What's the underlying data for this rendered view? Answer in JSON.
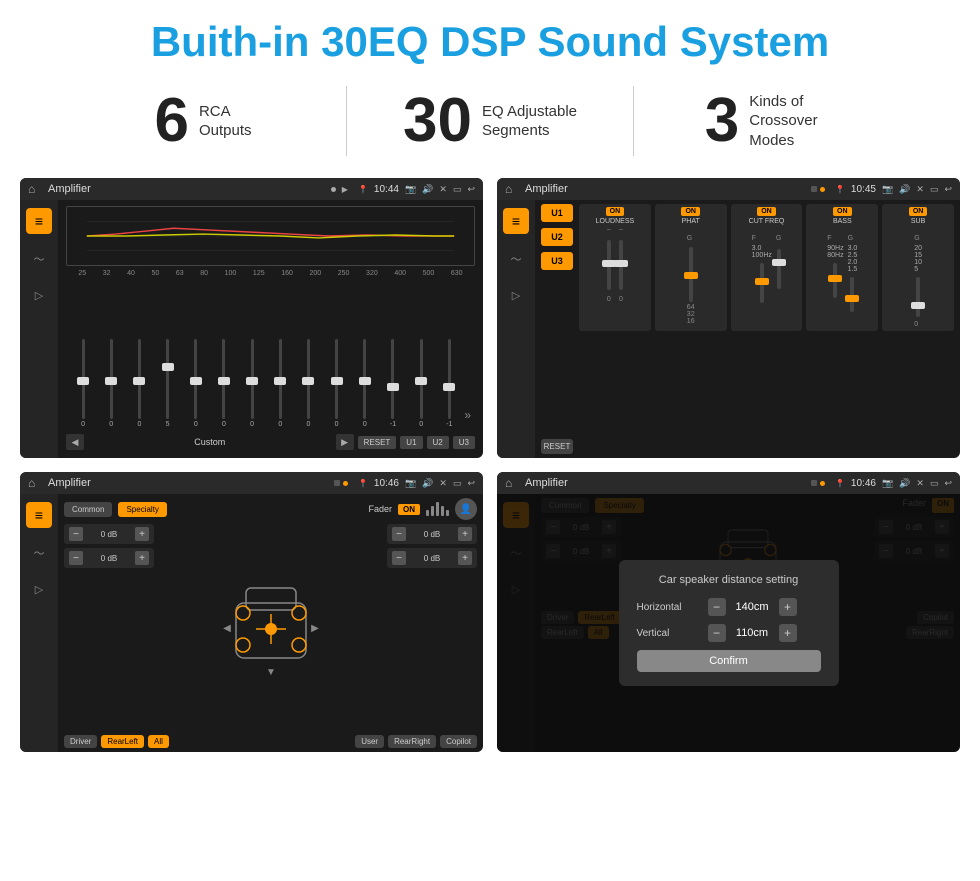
{
  "header": {
    "title": "Buith-in 30EQ DSP Sound System"
  },
  "stats": [
    {
      "number": "6",
      "label": "RCA\nOutputs"
    },
    {
      "number": "30",
      "label": "EQ Adjustable\nSegments"
    },
    {
      "number": "3",
      "label": "Kinds of\nCrossover Modes"
    }
  ],
  "screens": [
    {
      "id": "screen1",
      "appName": "Amplifier",
      "time": "10:44",
      "type": "eq"
    },
    {
      "id": "screen2",
      "appName": "Amplifier",
      "time": "10:45",
      "type": "amp"
    },
    {
      "id": "screen3",
      "appName": "Amplifier",
      "time": "10:46",
      "type": "crossover"
    },
    {
      "id": "screen4",
      "appName": "Amplifier",
      "time": "10:46",
      "type": "dialog"
    }
  ],
  "eq": {
    "freqLabels": [
      "25",
      "32",
      "40",
      "50",
      "63",
      "80",
      "100",
      "125",
      "160",
      "200",
      "250",
      "320",
      "400",
      "500",
      "630"
    ],
    "sliderValues": [
      "0",
      "0",
      "0",
      "5",
      "0",
      "0",
      "0",
      "0",
      "0",
      "0",
      "0",
      "-1",
      "0",
      "-1"
    ],
    "presets": [
      "Custom",
      "RESET",
      "U1",
      "U2",
      "U3"
    ]
  },
  "amp": {
    "presets": [
      "U1",
      "U2",
      "U3"
    ],
    "modules": [
      "LOUDNESS",
      "PHAT",
      "CUT FREQ",
      "BASS",
      "SUB"
    ]
  },
  "crossover": {
    "tabs": [
      "Common",
      "Specialty"
    ],
    "faderLabel": "Fader",
    "dbValues": [
      "0 dB",
      "0 dB",
      "0 dB",
      "0 dB"
    ],
    "locations": [
      "Driver",
      "RearLeft",
      "All",
      "User",
      "RearRight",
      "Copilot"
    ]
  },
  "dialog": {
    "title": "Car speaker distance setting",
    "horizontalLabel": "Horizontal",
    "horizontalValue": "140cm",
    "verticalLabel": "Vertical",
    "verticalValue": "110cm",
    "confirmLabel": "Confirm",
    "tabs": [
      "Common",
      "Specialty"
    ]
  },
  "ui": {
    "accentColor": "#f90",
    "bgColor": "#1a1a1a"
  }
}
